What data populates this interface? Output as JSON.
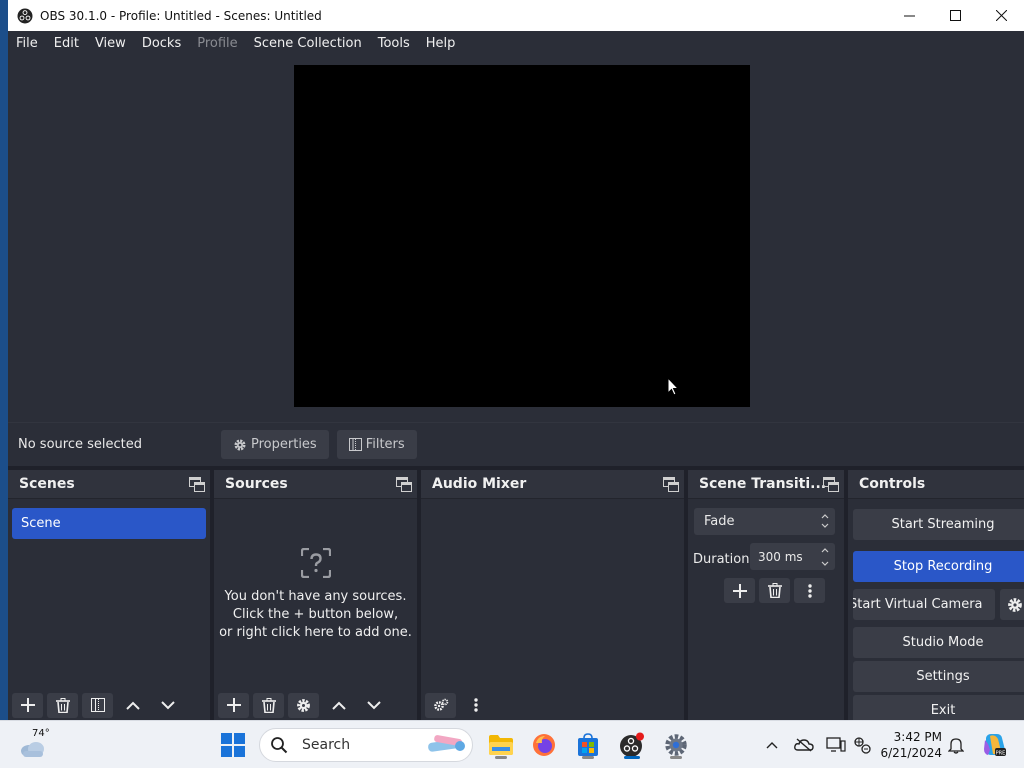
{
  "window": {
    "title": "OBS 30.1.0 - Profile: Untitled - Scenes: Untitled"
  },
  "menu": [
    "File",
    "Edit",
    "View",
    "Docks",
    "Profile",
    "Scene Collection",
    "Tools",
    "Help"
  ],
  "source_bar": {
    "status": "No source selected",
    "properties_label": "Properties",
    "filters_label": "Filters"
  },
  "docks": {
    "scenes": {
      "title": "Scenes",
      "items": [
        "Scene"
      ]
    },
    "sources": {
      "title": "Sources",
      "empty_line1": "You don't have any sources.",
      "empty_line2": "Click the + button below,",
      "empty_line3": "or right click here to add one."
    },
    "audio_mixer": {
      "title": "Audio Mixer"
    },
    "transitions": {
      "title": "Scene Transiti...",
      "selected": "Fade",
      "duration_label": "Duration",
      "duration_value": "300 ms"
    },
    "controls": {
      "title": "Controls",
      "start_streaming": "Start Streaming",
      "stop_recording": "Stop Recording",
      "start_virtual_camera": "Start Virtual Camera",
      "studio_mode": "Studio Mode",
      "settings": "Settings",
      "exit": "Exit"
    }
  },
  "taskbar": {
    "temperature": "74°",
    "search_placeholder": "Search",
    "time": "3:42 PM",
    "date": "6/21/2024"
  },
  "colors": {
    "panel": "#2b2e38",
    "header": "#30333d",
    "button": "#3a3d47",
    "accent": "#2a57c8",
    "background": "#1f212a"
  }
}
